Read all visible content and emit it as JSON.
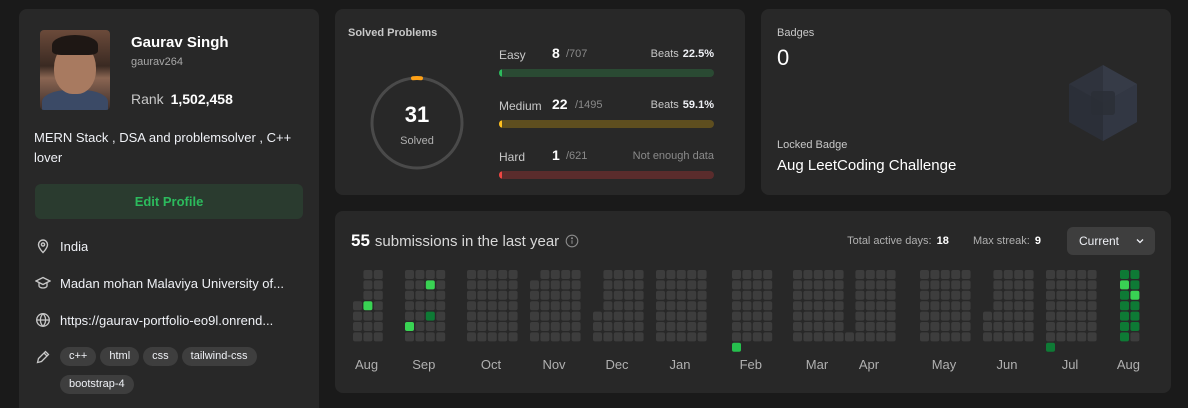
{
  "profile": {
    "name": "Gaurav Singh",
    "username": "gaurav264",
    "rank_label": "Rank",
    "rank_value": "1,502,458",
    "bio": "MERN Stack , DSA and problemsolver , C++ lover",
    "edit_button": "Edit Profile",
    "location": "India",
    "school": "Madan mohan Malaviya University of...",
    "website": "https://gaurav-portfolio-eo9l.onrend...",
    "skills": [
      "c++",
      "html",
      "css",
      "tailwind-css",
      "bootstrap-4"
    ],
    "icons": {
      "location": "map-pin-icon",
      "school": "graduation-cap-icon",
      "website": "globe-icon",
      "skills": "tag-icon"
    }
  },
  "solved": {
    "title": "Solved Problems",
    "total": "31",
    "total_label": "Solved",
    "easy": {
      "label": "Easy",
      "count": "8",
      "total": "/707",
      "beats_label": "Beats",
      "beats": "22.5%",
      "progress": 0.0113,
      "color": "#2cbb5d",
      "track": "#2a4a33"
    },
    "medium": {
      "label": "Medium",
      "count": "22",
      "total": "/1495",
      "beats_label": "Beats",
      "beats": "59.1%",
      "progress": 0.0147,
      "color": "#ffc01e",
      "track": "#5e4e1f"
    },
    "hard": {
      "label": "Hard",
      "count": "1",
      "total": "/621",
      "beats_label": "Not enough data",
      "beats": "",
      "progress": 0.0016,
      "color": "#ef4743",
      "track": "#5a2c2c"
    },
    "ring_color": "#ffa116"
  },
  "badges": {
    "label": "Badges",
    "count": "0",
    "locked_label": "Locked Badge",
    "locked_name": "Aug LeetCoding Challenge",
    "icon": "badge-hexagon-icon"
  },
  "calendar": {
    "count": "55",
    "label": "submissions in the last year",
    "active_days_label": "Total active days:",
    "active_days": "18",
    "max_streak_label": "Max streak:",
    "max_streak": "9",
    "select_value": "Current",
    "months": [
      "Aug",
      "Sep",
      "Oct",
      "Nov",
      "Dec",
      "Jan",
      "Feb",
      "Mar",
      "Apr",
      "May",
      "Jun",
      "Jul",
      "Aug"
    ],
    "colors": {
      "empty": "#3d3d3d",
      "level1": "#0e7a35",
      "level2": "#26c04e",
      "level3": "#39d353"
    }
  }
}
